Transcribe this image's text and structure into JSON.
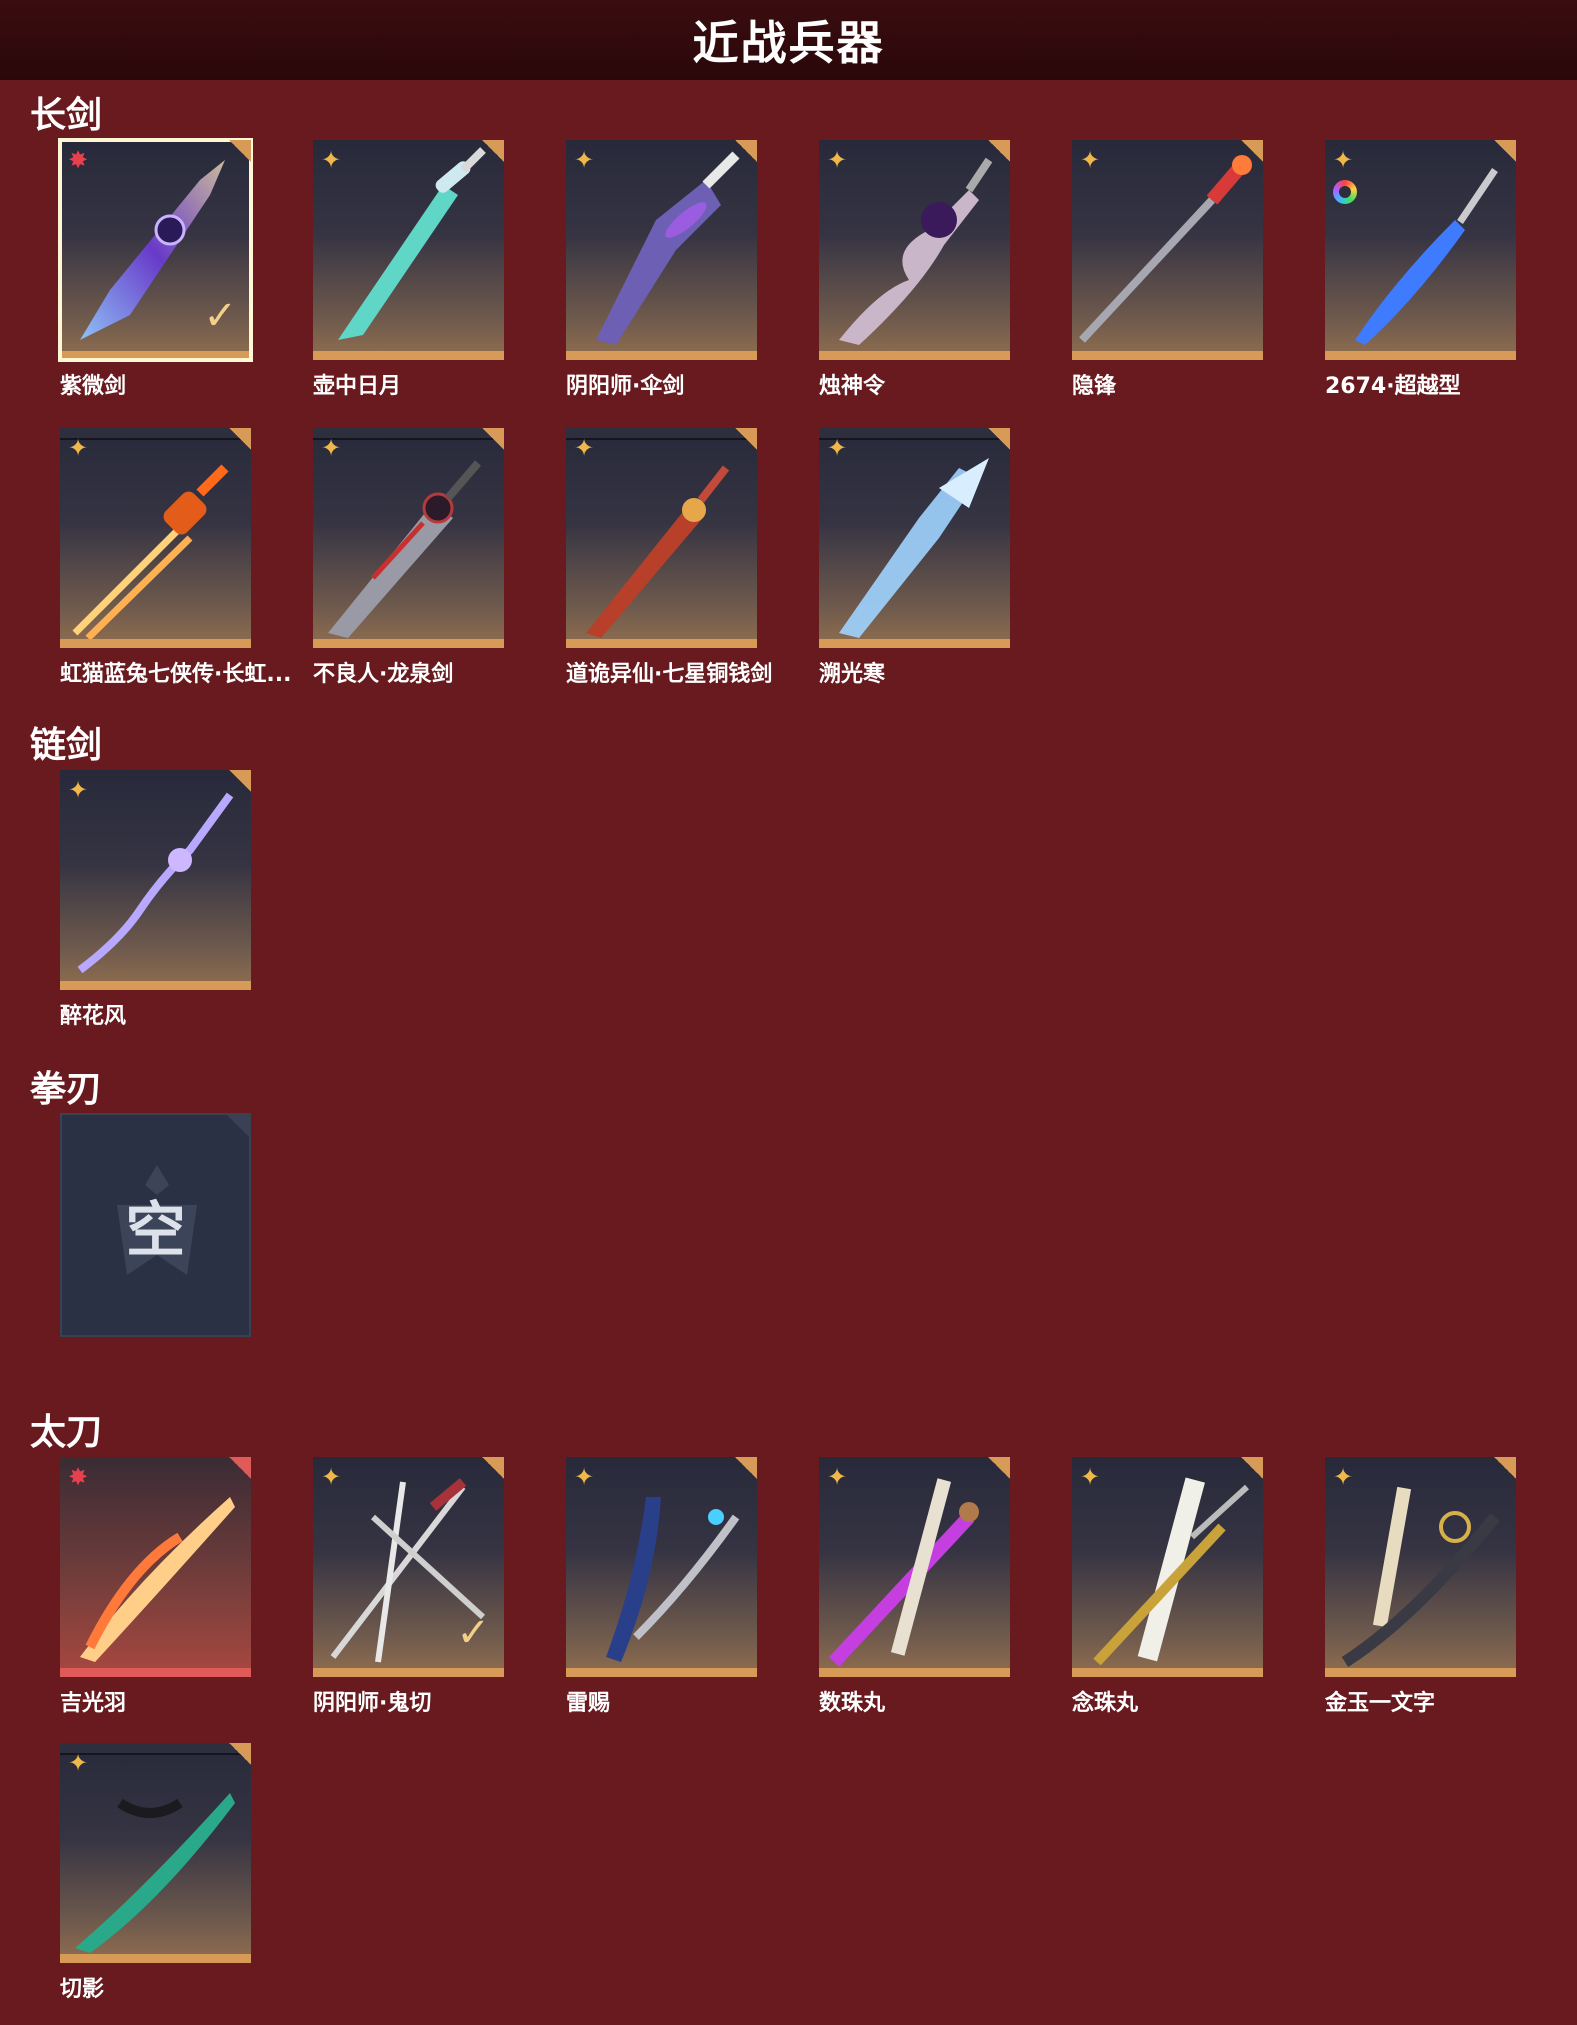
{
  "header": {
    "title": "近战兵器"
  },
  "sections": [
    {
      "title": "长剑",
      "items": [
        "紫微剑",
        "壶中日月",
        "阴阳师·伞剑",
        "烛神令",
        "隐锋",
        "2674·超越型",
        "虹猫蓝兔七侠传·长虹...",
        "不良人·龙泉剑",
        "道诡异仙·七星铜钱剑",
        "溯光寒"
      ]
    },
    {
      "title": "链剑",
      "items": [
        "醉花风"
      ]
    },
    {
      "title": "拳刃",
      "empty_label": "空"
    },
    {
      "title": "太刀",
      "items": [
        "吉光羽",
        "阴阳师·鬼切",
        "雷赐",
        "数珠丸",
        "念珠丸",
        "金玉一文字",
        "切影"
      ]
    }
  ],
  "colors": {
    "background": "#681a1f",
    "card_base": "#d79a57",
    "gold_star": "#f0b84a",
    "red_star": "#e7414f"
  }
}
